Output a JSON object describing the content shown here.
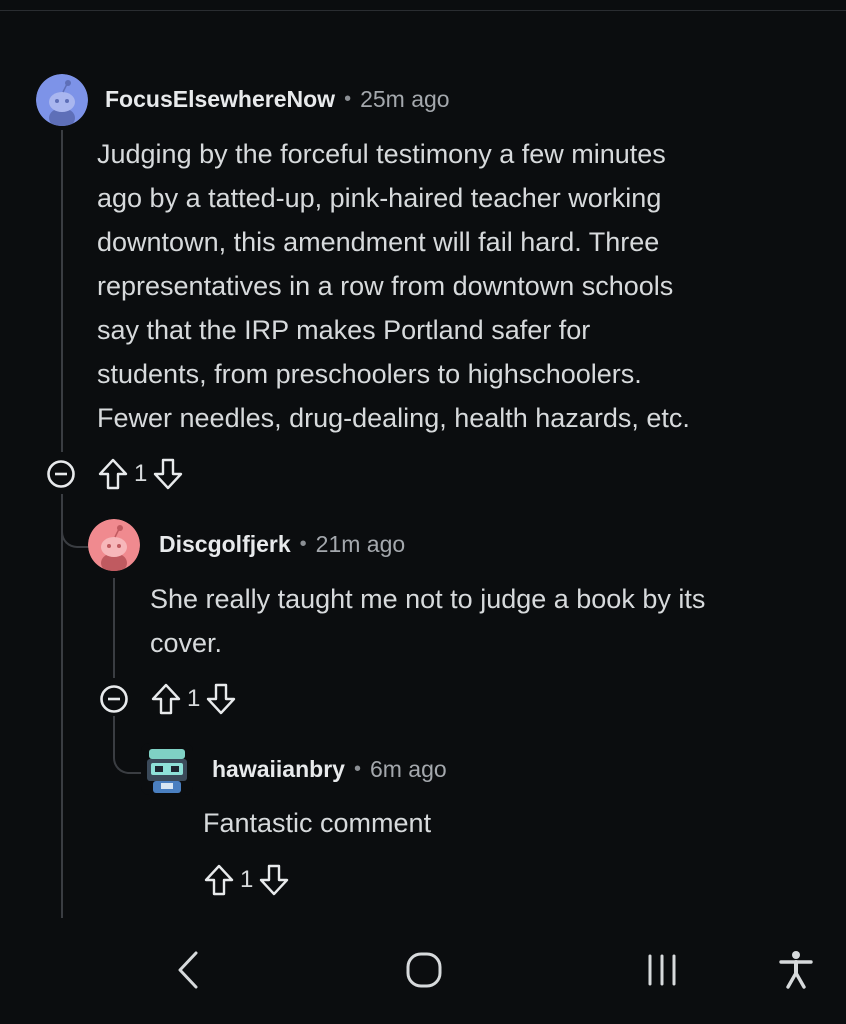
{
  "comments": [
    {
      "username": "FocusElsewhereNow",
      "separator": "•",
      "time": "25m ago",
      "lines": [
        "Judging by the forceful testimony a few minutes",
        "ago by a tatted-up, pink-haired teacher working",
        "downtown, this amendment will fail hard. Three",
        "representatives in a row from downtown schools",
        "say that the IRP makes Portland safer for",
        "students, from preschoolers to highschoolers.",
        "Fewer needles, drug-dealing, health hazards, etc."
      ],
      "score": "1",
      "avatar_color": "#7d93e8"
    },
    {
      "username": "Discgolfjerk",
      "separator": "•",
      "time": "21m ago",
      "lines": [
        "She really taught me not to judge a book by its",
        "cover."
      ],
      "score": "1",
      "avatar_color": "#f08a8f"
    },
    {
      "username": "hawaiianbry",
      "separator": "•",
      "time": "6m ago",
      "lines": [
        "Fantastic comment"
      ],
      "score": "1",
      "avatar_color": "#5aa6d6"
    }
  ],
  "icons": {
    "collapse": "minus-circle-icon",
    "upvote": "upvote-arrow-icon",
    "downvote": "downvote-arrow-icon"
  },
  "navbar": {
    "back": "back-chevron-icon",
    "home": "home-icon",
    "recents": "recents-icon",
    "accessibility": "accessibility-icon"
  },
  "colors": {
    "background": "#0b0d0f",
    "text": "#d7dadc",
    "thread": "#3a3d42"
  }
}
